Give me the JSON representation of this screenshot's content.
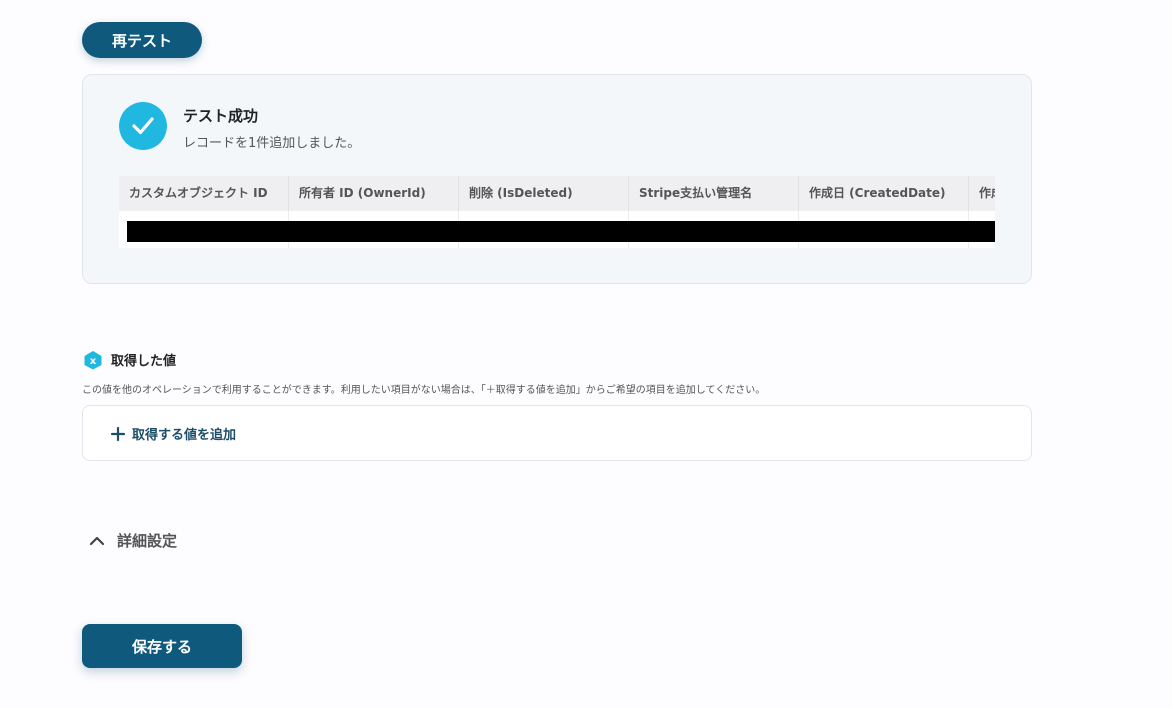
{
  "toolbar": {
    "retest_label": "再テスト"
  },
  "result": {
    "title": "テスト成功",
    "subtitle": "レコードを1件追加しました。",
    "status_icon": "check-icon",
    "accent_color": "#20b8e0",
    "table": {
      "columns": [
        "カスタムオブジェクト ID",
        "所有者 ID (OwnerId)",
        "削除 (IsDeleted)",
        "Stripe支払い管理名",
        "作成日 (CreatedDate)",
        "作成"
      ]
    }
  },
  "acquired_values": {
    "icon": "variable-icon",
    "title": "取得した値",
    "description": "この値を他のオペレーションで利用することができます。利用したい項目がない場合は、「＋取得する値を追加」からご希望の項目を追加してください。",
    "add_label": "取得する値を追加",
    "add_icon": "plus-icon"
  },
  "details": {
    "label": "詳細設定",
    "icon": "chevron-up-icon"
  },
  "footer": {
    "save_label": "保存する"
  },
  "colors": {
    "primary": "#0f5a7c",
    "link": "#1c4e68"
  }
}
